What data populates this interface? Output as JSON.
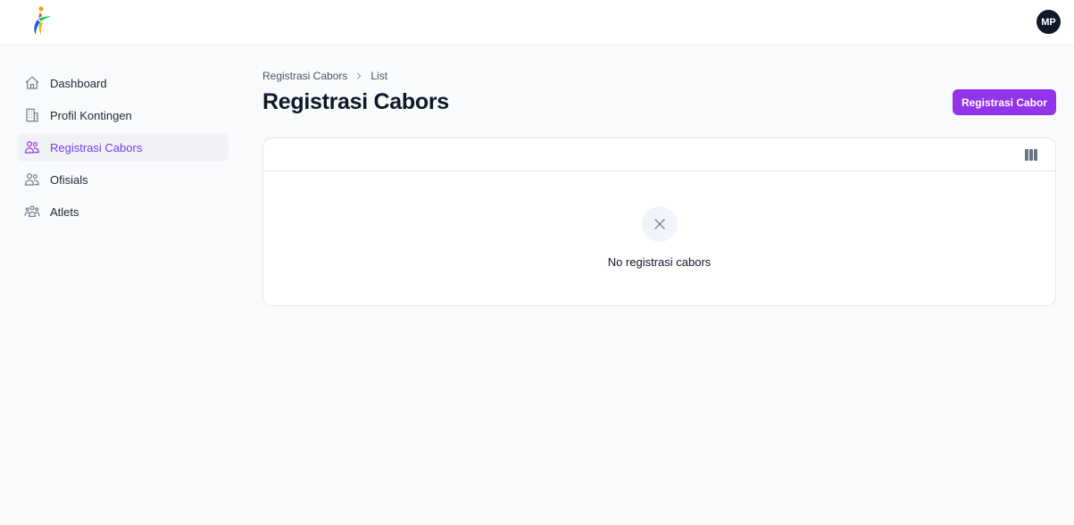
{
  "header": {
    "avatar_initials": "MP",
    "logo_icon": "torch-figure-logo"
  },
  "sidebar": {
    "items": [
      {
        "label": "Dashboard",
        "icon": "home-icon",
        "active": false
      },
      {
        "label": "Profil Kontingen",
        "icon": "building-icon",
        "active": false
      },
      {
        "label": "Registrasi Cabors",
        "icon": "users-icon",
        "active": true
      },
      {
        "label": "Ofisials",
        "icon": "users-icon",
        "active": false
      },
      {
        "label": "Atlets",
        "icon": "user-group-icon",
        "active": false
      }
    ]
  },
  "main": {
    "breadcrumb": [
      "Registrasi Cabors",
      "List"
    ],
    "title": "Registrasi Cabors",
    "primary_button": "Registrasi Cabor",
    "table": {
      "column_toggle_icon": "columns-icon",
      "empty_icon": "x-mark-icon",
      "empty_text": "No registrasi cabors"
    }
  },
  "colors": {
    "accent": "#9333ea",
    "active_text": "#7c3aed",
    "background": "#f8fafc"
  }
}
